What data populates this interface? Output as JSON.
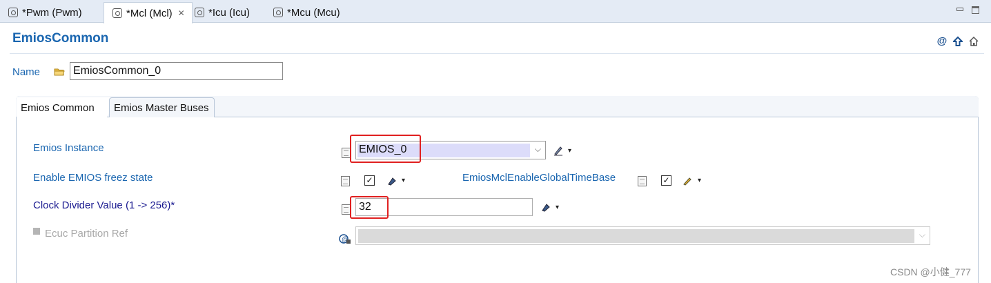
{
  "editor_tabs": [
    {
      "label": "*Pwm (Pwm)",
      "active": false
    },
    {
      "label": "*Mcl (Mcl)",
      "active": true
    },
    {
      "label": "*Icu (Icu)",
      "active": false
    },
    {
      "label": "*Mcu (Mcu)",
      "active": false
    }
  ],
  "tab_close_glyph": "✕",
  "header": {
    "title": "EmiosCommon",
    "icons": [
      "at-icon",
      "up-arrow-icon",
      "home-icon"
    ]
  },
  "name_field": {
    "label": "Name",
    "value": "EmiosCommon_0"
  },
  "form_tabs": [
    {
      "label": "Emios Common",
      "active": true
    },
    {
      "label": "Emios Master Buses",
      "active": false
    }
  ],
  "fields": {
    "emios_instance": {
      "label": "Emios Instance",
      "value": "EMIOS_0"
    },
    "enable_freez": {
      "label": "Enable EMIOS freez state",
      "checked": true
    },
    "global_time_base": {
      "label": "EmiosMclEnableGlobalTimeBase",
      "checked": true
    },
    "clock_divider": {
      "label": "Clock Divider Value (1 -> 256)*",
      "value": "32"
    },
    "ecuc_partition": {
      "label": "Ecuc Partition Ref",
      "value": "",
      "enabled": false
    }
  },
  "glyphs": {
    "check": "✓",
    "dropdown_arrow": "▾",
    "combo_arrow": "⌵"
  },
  "watermark": "CSDN @小健_777",
  "colors": {
    "link_blue": "#1a66b0",
    "required_navy": "#1a1a90",
    "highlight_red": "#e02020"
  }
}
